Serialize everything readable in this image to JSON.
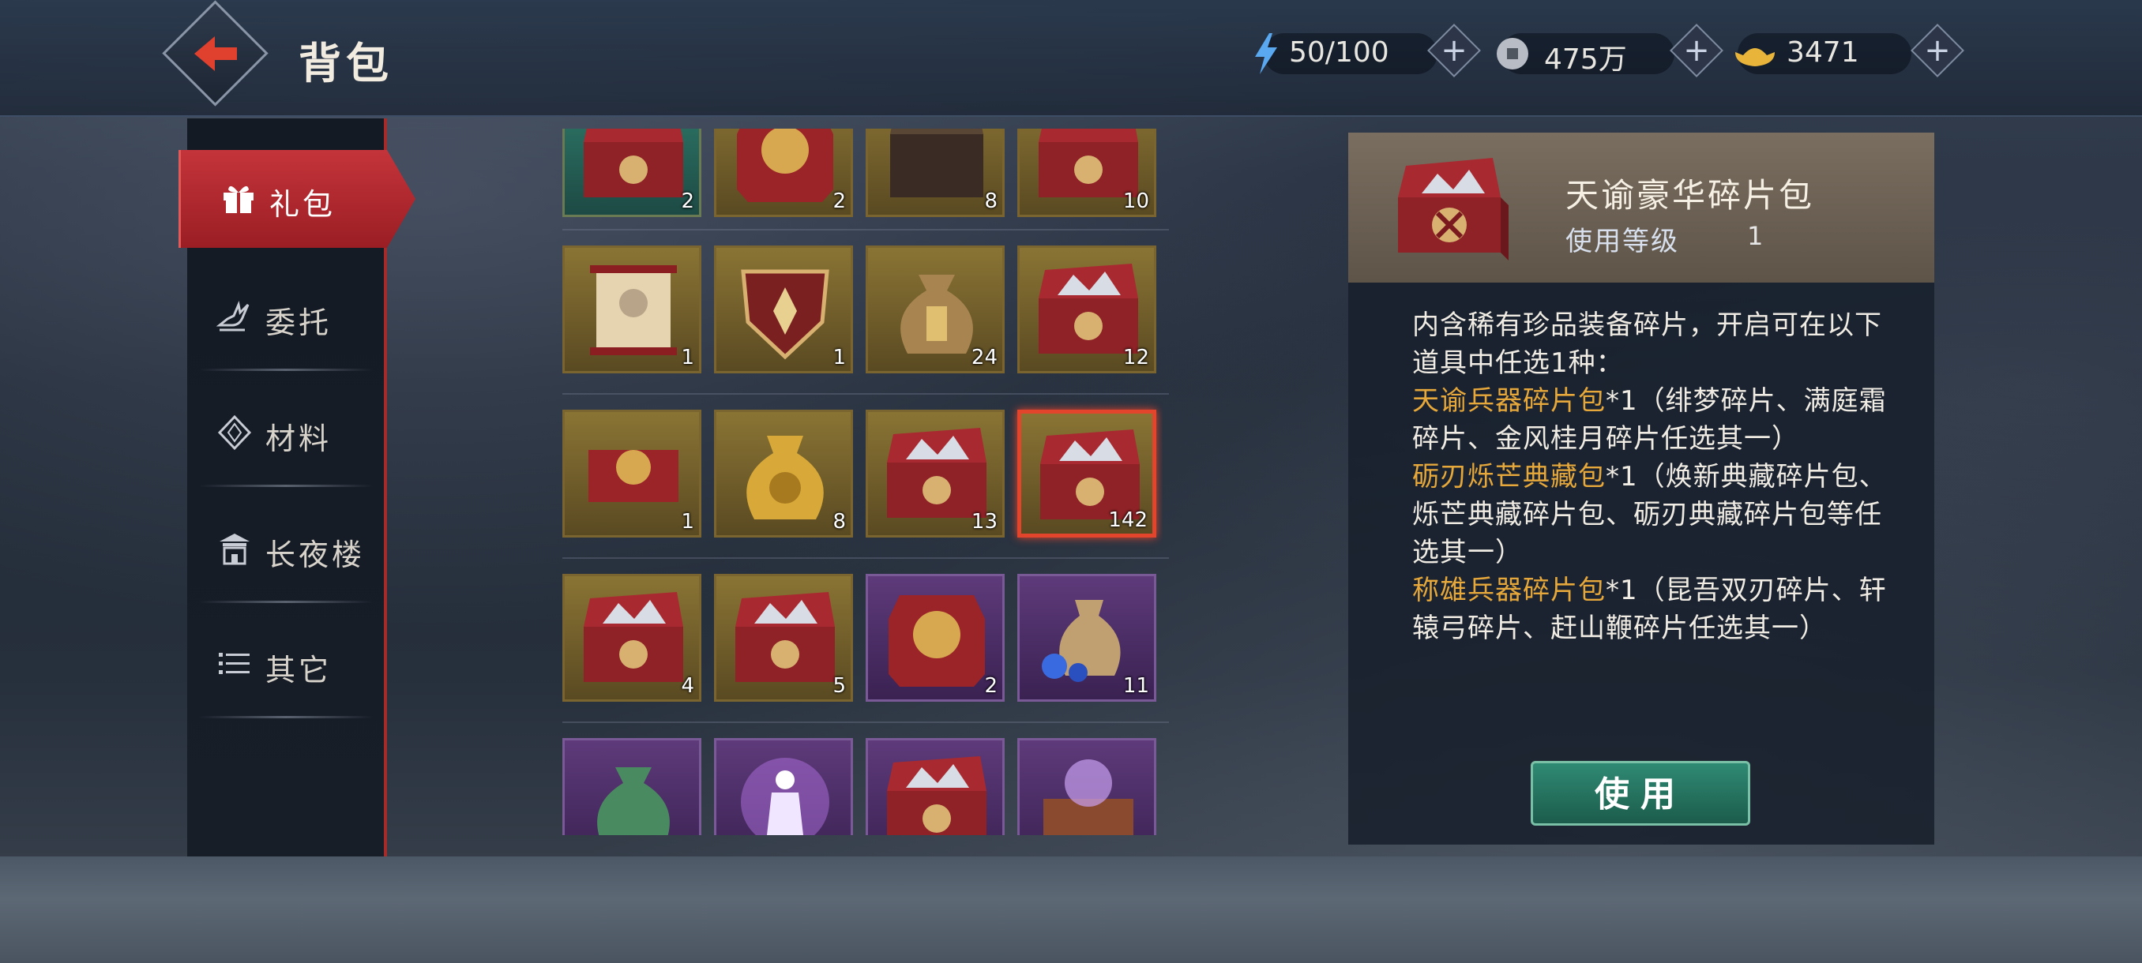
{
  "header": {
    "title": "背包",
    "stamina": "50/100",
    "silver": "475万",
    "gold": "3471"
  },
  "sidebar": {
    "items": [
      {
        "label": "礼包",
        "icon": "gift-icon",
        "active": true
      },
      {
        "label": "委托",
        "icon": "hand-icon"
      },
      {
        "label": "材料",
        "icon": "diamond-icon"
      },
      {
        "label": "长夜楼",
        "icon": "pavilion-icon"
      },
      {
        "label": "其它",
        "icon": "list-icon"
      }
    ]
  },
  "inventory": {
    "rows": [
      [
        {
          "count": "2",
          "frame": "green",
          "icon": "red-chest-icon"
        },
        {
          "count": "2",
          "frame": "gold",
          "icon": "red-box-icon"
        },
        {
          "count": "8",
          "frame": "gold",
          "icon": "dark-chest-icon"
        },
        {
          "count": "10",
          "frame": "gold",
          "icon": "red-chest-icon"
        }
      ],
      [
        {
          "count": "1",
          "frame": "gold",
          "icon": "scroll-icon"
        },
        {
          "count": "1",
          "frame": "gold",
          "icon": "shield-icon"
        },
        {
          "count": "24",
          "frame": "gold",
          "icon": "pouch-icon"
        },
        {
          "count": "12",
          "frame": "gold",
          "icon": "shard-chest-icon"
        }
      ],
      [
        {
          "count": "1",
          "frame": "gold",
          "icon": "jewel-box-icon"
        },
        {
          "count": "8",
          "frame": "gold",
          "icon": "gold-pouch-icon"
        },
        {
          "count": "13",
          "frame": "gold",
          "icon": "shard-chest-icon"
        },
        {
          "count": "142",
          "frame": "gold",
          "icon": "shard-chest-icon",
          "selected": true
        }
      ],
      [
        {
          "count": "4",
          "frame": "gold",
          "icon": "shard-chest-icon"
        },
        {
          "count": "5",
          "frame": "gold",
          "icon": "shard-chest-icon"
        },
        {
          "count": "2",
          "frame": "purple",
          "icon": "red-box-icon"
        },
        {
          "count": "11",
          "frame": "purple",
          "icon": "orb-pouch-icon"
        }
      ],
      [
        {
          "count": "",
          "frame": "purple",
          "icon": "green-pouch-icon"
        },
        {
          "count": "",
          "frame": "purple",
          "icon": "figure-icon"
        },
        {
          "count": "",
          "frame": "purple",
          "icon": "shard-chest-icon"
        },
        {
          "count": "",
          "frame": "purple",
          "icon": "magic-chest-icon"
        }
      ]
    ]
  },
  "detail": {
    "name": "天谕豪华碎片包",
    "level_label": "使用等级",
    "level": "1",
    "desc_intro": "内含稀有珍品装备碎片，开启可在以下道具中任选1种：",
    "options": [
      {
        "name": "天谕兵器碎片包",
        "rest": "*1（绯梦碎片、满庭霜碎片、金风桂月碎片任选其一）"
      },
      {
        "name": "砺刃烁芒典藏包",
        "rest": "*1（焕新典藏碎片包、烁芒典藏碎片包、砺刃典藏碎片包等任选其一）"
      },
      {
        "name": "称雄兵器碎片包",
        "rest": "*1（昆吾双刃碎片、轩辕弓碎片、赶山鞭碎片任选其一）"
      }
    ],
    "use_label": "使用"
  },
  "colors": {
    "accent_red": "#c4343a",
    "option_gold": "#e6a83a",
    "use_green": "#2f8a74",
    "selected_border": "#e3452c"
  }
}
